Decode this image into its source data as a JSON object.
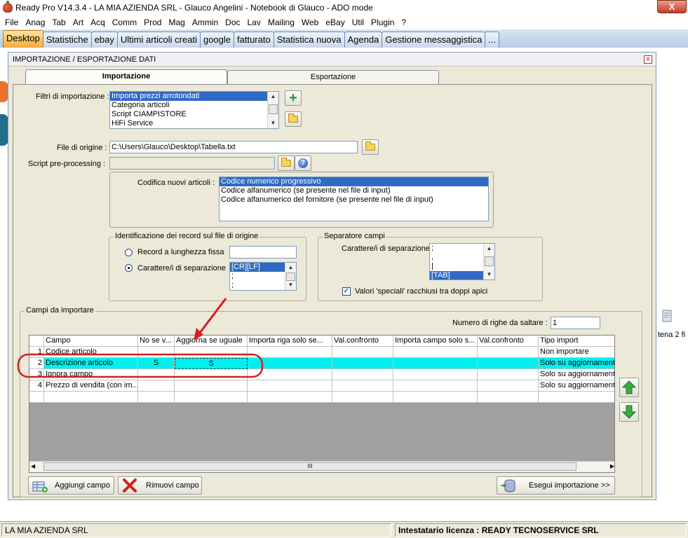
{
  "window": {
    "title": "Ready Pro V14.3.4 - LA MIA AZIENDA SRL - Glauco Angelini - Notebook di Glauco - ADO mode",
    "close_glyph": "X"
  },
  "menu": [
    "File",
    "Anag",
    "Tab",
    "Art",
    "Acq",
    "Comm",
    "Prod",
    "Mag",
    "Ammin",
    "Doc",
    "Lav",
    "Mailing",
    "Web",
    "eBay",
    "Util",
    "Plugin",
    "?"
  ],
  "tabs": [
    "Desktop",
    "Statistiche",
    "ebay",
    "Ultimi articoli creati",
    "google",
    "fatturato",
    "Statistica nuova",
    "Agenda",
    "Gestione messaggistica",
    "..."
  ],
  "dialog": {
    "title": "IMPORTAZIONE / ESPORTAZIONE DATI",
    "close_glyph": "x",
    "tabs": {
      "import": "Importazione",
      "export": "Esportazione"
    },
    "filters": {
      "label": "Filtri di importazione :",
      "items": [
        "Importa prezzi arrotondati",
        "Categoria articoli",
        "Script CIAMPISTORE",
        "HiFi Service"
      ],
      "selected_index": 0
    },
    "source_file": {
      "label": "File di origine :",
      "value": "C:\\Users\\Glauco\\Desktop\\Tabella.txt"
    },
    "script": {
      "label": "Script pre-processing :",
      "value": ""
    },
    "encoding": {
      "label": "Codifica nuovi articoli :",
      "items": [
        "Codice numerico progressivo",
        "Codice alfanumerico (se presente nel file di input)",
        "Codice alfanumerico del fornitore (se presente nel file di input)"
      ],
      "selected_index": 0
    },
    "record_id": {
      "title": "Identificazione dei record sul file di origine",
      "fixed_label": "Record a lunghezza fissa",
      "sep_label": "Carattere/i di separazione",
      "selected": "sep",
      "sep_values": [
        "[CR][LF]",
        ";",
        ";"
      ]
    },
    "field_sep": {
      "title": "Separatore campi",
      "label": "Carattere/i di separazione",
      "values": [
        ";",
        ",",
        "|",
        "[TAB]"
      ],
      "selected_index": 3,
      "special_label": "Valori 'speciali' racchiusi tra doppi apici",
      "special_checked": true,
      "check_glyph": "✓"
    },
    "fields": {
      "title": "Campi da importare",
      "skip_label": "Numero di righe da saltare :",
      "skip_value": "1",
      "columns": [
        "Campo",
        "No se v...",
        "Aggiorna se uguale",
        "Importa riga solo se...",
        "Val.confronto",
        "Importa campo solo s...",
        "Val.confronto",
        "Tipo import"
      ],
      "rows": [
        {
          "n": "1",
          "campo": "Codice articolo",
          "nosev": "",
          "agg": "",
          "tipo": "Non importare"
        },
        {
          "n": "2",
          "campo": "Descrizione articolo",
          "nosev": "S",
          "agg": "S",
          "tipo": "Solo su aggiornamenti"
        },
        {
          "n": "3",
          "campo": "Ignora campo",
          "nosev": "",
          "agg": "",
          "tipo": "Solo su aggiornamenti"
        },
        {
          "n": "4",
          "campo": "Prezzo di vendita (con im...",
          "nosev": "",
          "agg": "",
          "tipo": "Solo su aggiornamenti"
        }
      ],
      "selected_row": 1,
      "scroll_thumb_glyph": "III"
    },
    "buttons": {
      "add": "Aggiungi campo",
      "remove": "Rimuovi campo",
      "run": "Esegui importazione >>"
    }
  },
  "background_label": "tena 2 fi",
  "status": {
    "left": "LA MIA AZIENDA SRL",
    "right": "Intestatario licenza : READY TECNOSERVICE SRL"
  },
  "colors": {
    "selection": "#316ac5",
    "row_highlight": "#00f0f0",
    "annotation": "#d42020",
    "active_tab": "#f7a93b"
  }
}
